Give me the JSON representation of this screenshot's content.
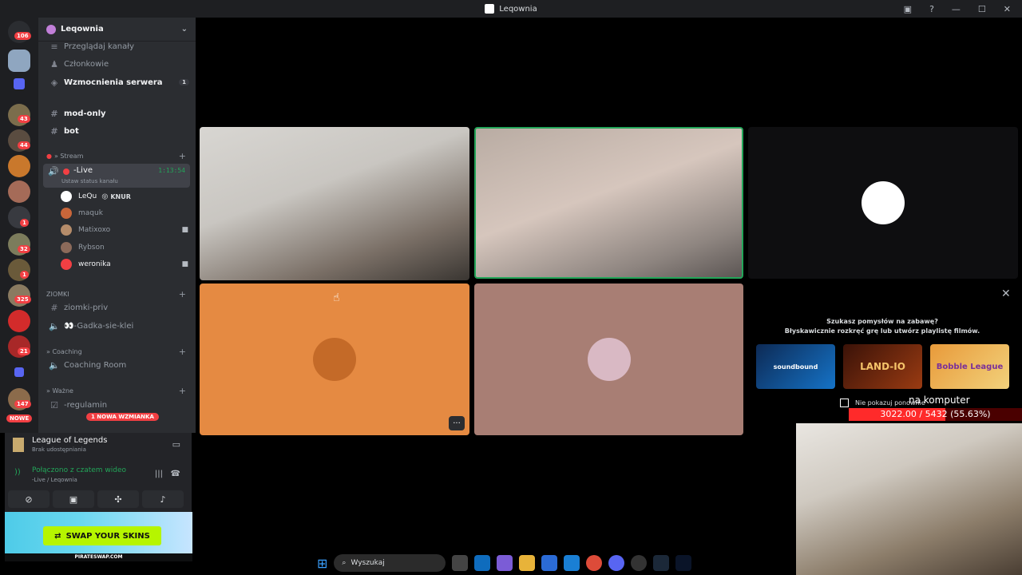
{
  "window": {
    "title": "Leqownia",
    "controls": [
      "—",
      "☐",
      "✕"
    ]
  },
  "rail": {
    "badges": [
      "106",
      "43",
      "44",
      "325",
      "32",
      "21",
      "147",
      "1",
      "1"
    ],
    "new_label": "NOWE"
  },
  "server": {
    "name": "Leqownia"
  },
  "sidebar": {
    "browse_channels": "Przeglądaj kanały",
    "members": "Członkowie",
    "boosts": "Wzmocnienia serwera",
    "boosts_count": "1",
    "mod_only": "mod-only",
    "bot": "bot",
    "cat_stream": "» Stream",
    "live_channel": "-Live",
    "live_timer": "1:13:54",
    "live_status": "Ustaw status kanału",
    "users": [
      {
        "name": "LeQu",
        "extra": "😝 KNUR"
      },
      {
        "name": "maquk",
        "extra": ""
      },
      {
        "name": "Matixoxo",
        "extra": ""
      },
      {
        "name": "Rybson",
        "extra": ""
      },
      {
        "name": "weronika",
        "extra": ""
      }
    ],
    "cat_ziomki": "ZIOMKI",
    "ziomki_priv": "ziomki-priv",
    "gadka": "👀-Gadka-sie-klei",
    "cat_coaching": "» Coaching",
    "coaching_room": "Coaching Room",
    "cat_wazne": "» Ważne",
    "regulamin": "-regulamin",
    "mention_pill": "1 NOWA WZMIANKA"
  },
  "panel": {
    "activity_title": "League of Legends",
    "activity_sub": "Brak udostępniania",
    "connected": "Połączono z czatem wideo",
    "connected_sub": "-Live / Leqownia"
  },
  "ad": {
    "cta": "SWAP YOUR SKINS",
    "footer": "PIRATESWAP.COM"
  },
  "activity": {
    "line1": "Szukasz pomysłów na zabawę?",
    "line2": "Błyskawicznie rozkręć grę lub utwórz playlistę filmów.",
    "games": [
      "soundbound",
      "LAND-IO",
      "Bobble League"
    ],
    "dont_show": "Nie pokazuj ponownie"
  },
  "overlay": {
    "label": "na komputer",
    "progress_text": "3022.00 / 5432 (55.63%)",
    "progress_fraction": 0.5563
  },
  "taskbar": {
    "search_placeholder": "Wyszukaj"
  },
  "colors": {
    "live_green": "#23a559",
    "mention_red": "#f23f43",
    "sidebar": "#2b2d31",
    "rail": "#1e1f22"
  }
}
